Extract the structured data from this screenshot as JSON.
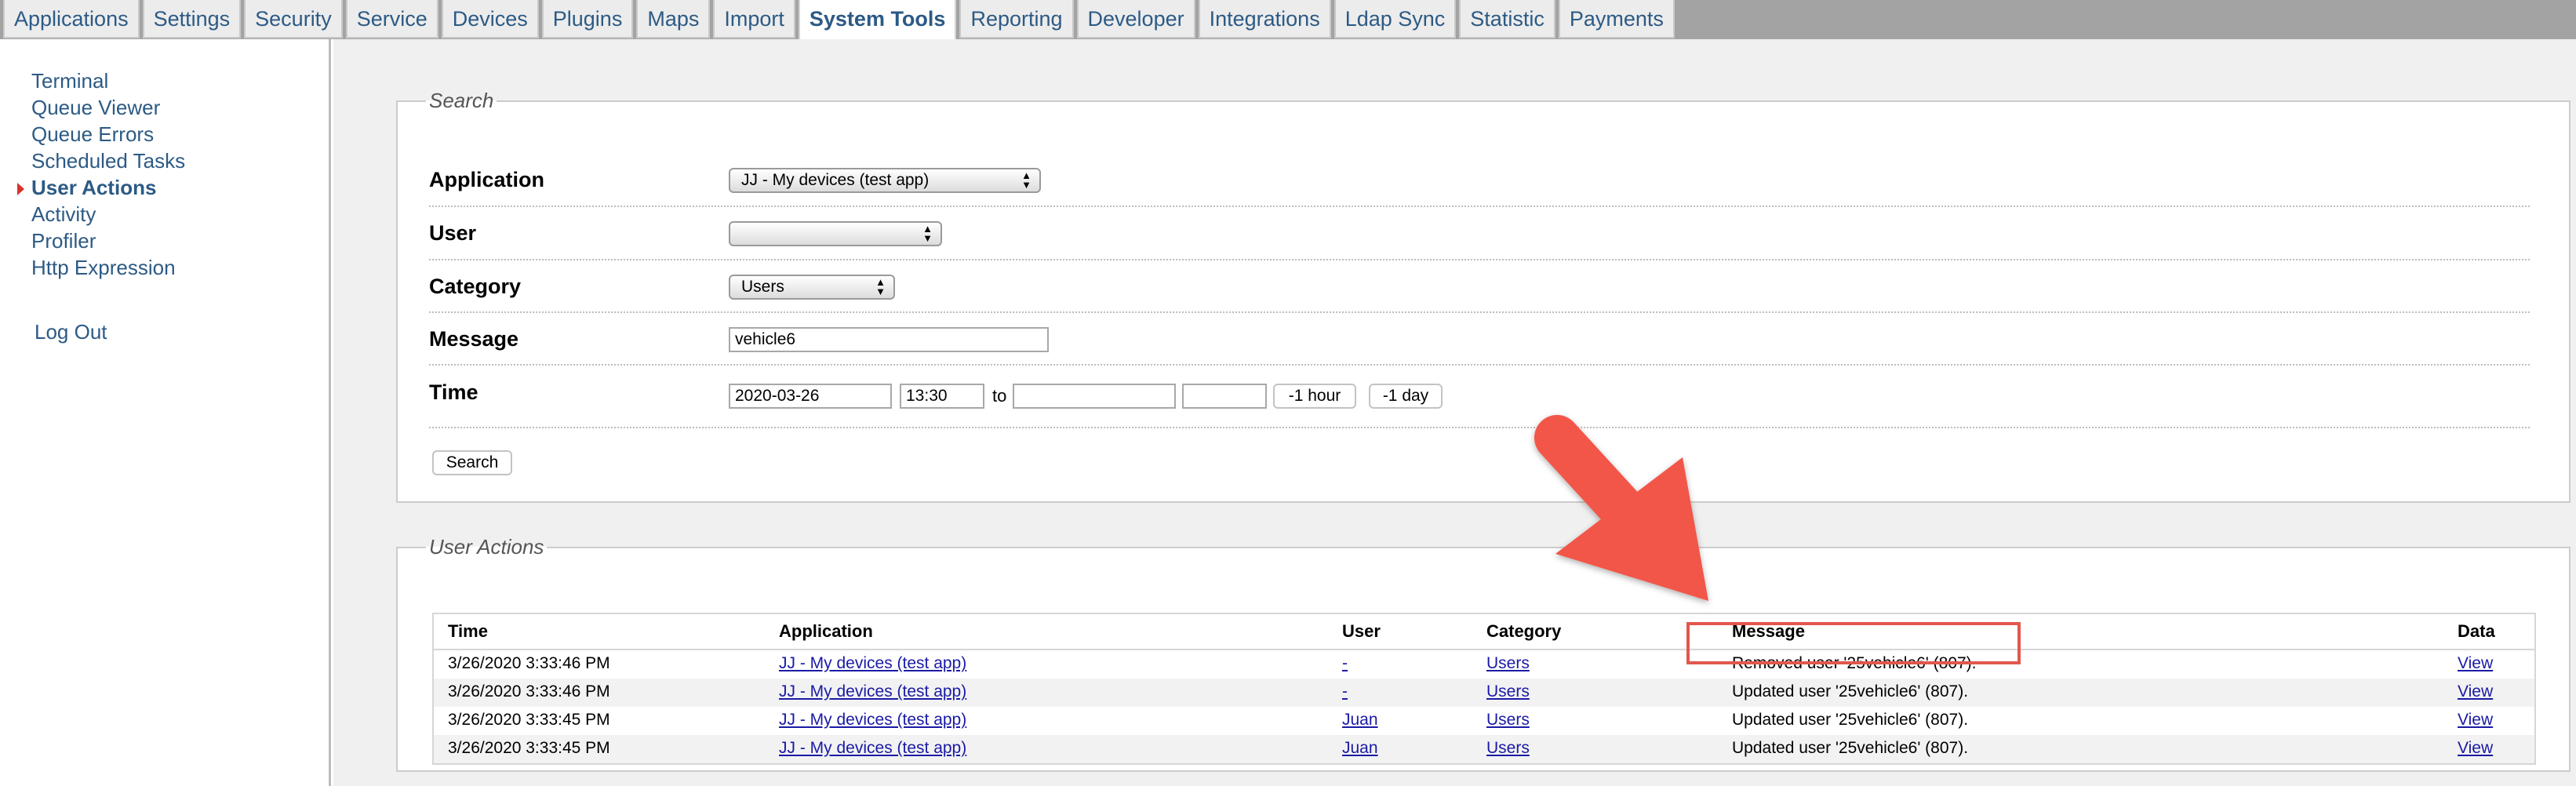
{
  "tabs": [
    {
      "label": "Applications",
      "active": false
    },
    {
      "label": "Settings",
      "active": false
    },
    {
      "label": "Security",
      "active": false
    },
    {
      "label": "Service",
      "active": false
    },
    {
      "label": "Devices",
      "active": false
    },
    {
      "label": "Plugins",
      "active": false
    },
    {
      "label": "Maps",
      "active": false
    },
    {
      "label": "Import",
      "active": false
    },
    {
      "label": "System Tools",
      "active": true
    },
    {
      "label": "Reporting",
      "active": false
    },
    {
      "label": "Developer",
      "active": false
    },
    {
      "label": "Integrations",
      "active": false
    },
    {
      "label": "Ldap Sync",
      "active": false
    },
    {
      "label": "Statistic",
      "active": false
    },
    {
      "label": "Payments",
      "active": false
    }
  ],
  "sidebar": {
    "items": [
      {
        "label": "Terminal"
      },
      {
        "label": "Queue Viewer"
      },
      {
        "label": "Queue Errors"
      },
      {
        "label": "Scheduled Tasks"
      },
      {
        "label": "User Actions",
        "active": true
      },
      {
        "label": "Activity"
      },
      {
        "label": "Profiler"
      },
      {
        "label": "Http Expression"
      }
    ],
    "logout": "Log Out"
  },
  "search": {
    "legend": "Search",
    "application": {
      "label": "Application",
      "value": "JJ - My devices (test app)"
    },
    "user": {
      "label": "User",
      "value": ""
    },
    "category": {
      "label": "Category",
      "value": "Users"
    },
    "message": {
      "label": "Message",
      "value": "vehicle6"
    },
    "time": {
      "label": "Time",
      "from_date": "2020-03-26",
      "from_time": "13:30",
      "to_label": "to",
      "to_date": "",
      "to_time": "",
      "minus_hour": "-1 hour",
      "minus_day": "-1 day"
    },
    "submit": "Search"
  },
  "results": {
    "legend": "User Actions",
    "columns": [
      "Time",
      "Application",
      "User",
      "Category",
      "Message",
      "Data"
    ],
    "rows": [
      {
        "time": "3/26/2020 3:33:46 PM",
        "application": "JJ - My devices (test app)",
        "user": "-",
        "category": "Users",
        "message": "Removed user '25vehicle6' (807).",
        "data": "View"
      },
      {
        "time": "3/26/2020 3:33:46 PM",
        "application": "JJ - My devices (test app)",
        "user": "-",
        "category": "Users",
        "message": "Updated user '25vehicle6' (807).",
        "data": "View"
      },
      {
        "time": "3/26/2020 3:33:45 PM",
        "application": "JJ - My devices (test app)",
        "user": "Juan",
        "category": "Users",
        "message": "Updated user '25vehicle6' (807).",
        "data": "View"
      },
      {
        "time": "3/26/2020 3:33:45 PM",
        "application": "JJ - My devices (test app)",
        "user": "Juan",
        "category": "Users",
        "message": "Updated user '25vehicle6' (807).",
        "data": "View"
      }
    ]
  },
  "annotation": {
    "color": "#e2574c"
  }
}
